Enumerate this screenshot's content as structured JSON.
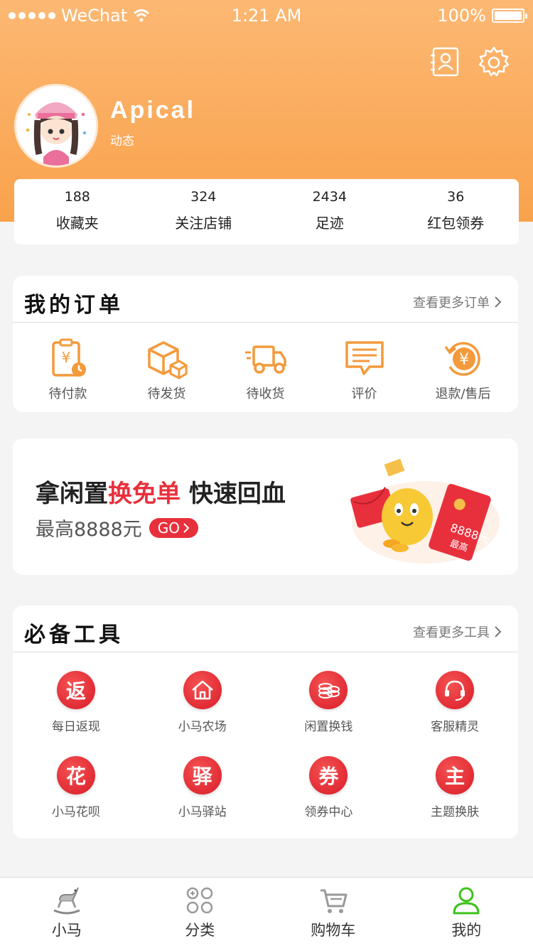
{
  "status": {
    "carrier": "WeChat",
    "time": "1:21 AM",
    "battery": "100%"
  },
  "profile": {
    "name": "Apical",
    "subtitle": "动态"
  },
  "stats": [
    {
      "num": "188",
      "label": "收藏夹"
    },
    {
      "num": "324",
      "label": "关注店铺"
    },
    {
      "num": "2434",
      "label": "足迹"
    },
    {
      "num": "36",
      "label": "红包领券"
    }
  ],
  "orders": {
    "title": "我的订单",
    "more": "查看更多订单",
    "items": [
      {
        "label": "待付款",
        "icon": "pending-payment-icon"
      },
      {
        "label": "待发货",
        "icon": "to-ship-box-icon"
      },
      {
        "label": "待收货",
        "icon": "delivery-truck-icon"
      },
      {
        "label": "评价",
        "icon": "review-chat-icon"
      },
      {
        "label": "退款/售后",
        "icon": "refund-yen-icon"
      }
    ]
  },
  "banner": {
    "title_a": "拿闲置",
    "title_red": "换免单",
    "title_b": " 快速回血",
    "sub": "最高8888元",
    "go": "GO",
    "art_text": "8888元",
    "art_text2": "最高"
  },
  "tools": {
    "title": "必备工具",
    "more": "查看更多工具",
    "items": [
      {
        "glyph": "返",
        "label": "每日返现"
      },
      {
        "glyph": "",
        "label": "小马农场",
        "icon": "house-icon"
      },
      {
        "glyph": "",
        "label": "闲置换钱",
        "icon": "coins-icon"
      },
      {
        "glyph": "",
        "label": "客服精灵",
        "icon": "headset-icon"
      },
      {
        "glyph": "花",
        "label": "小马花呗"
      },
      {
        "glyph": "驿",
        "label": "小马驿站"
      },
      {
        "glyph": "券",
        "label": "领券中心"
      },
      {
        "glyph": "主",
        "label": "主题换肤"
      }
    ]
  },
  "tabs": [
    {
      "label": "小马",
      "icon": "rocking-horse-icon"
    },
    {
      "label": "分类",
      "icon": "category-grid-icon"
    },
    {
      "label": "购物车",
      "icon": "cart-icon"
    },
    {
      "label": "我的",
      "icon": "user-icon",
      "active": true
    }
  ],
  "colors": {
    "accent": "#f9a24c",
    "red": "#e8303c",
    "active_tab": "#3cc21a",
    "icon_orange": "#f39a3c"
  }
}
